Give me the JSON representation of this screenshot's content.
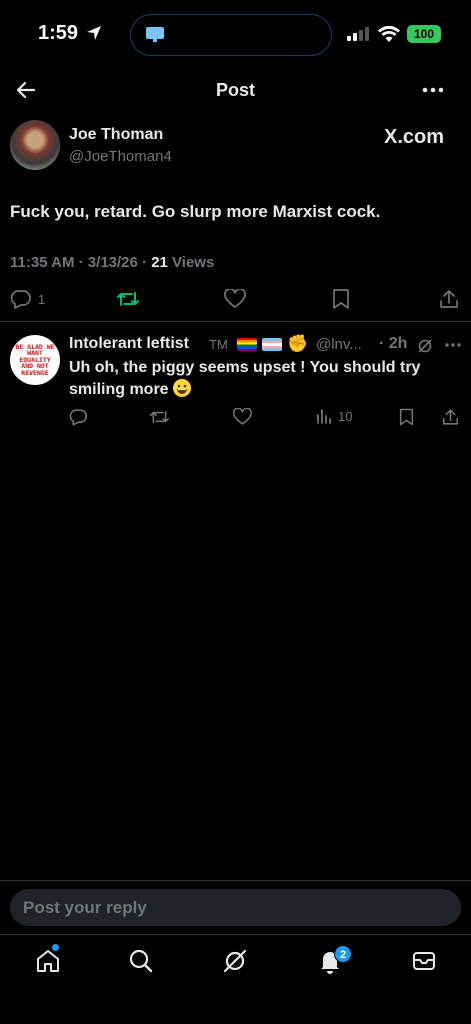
{
  "status_bar": {
    "time": "1:59",
    "battery": "100"
  },
  "header": {
    "title": "Post"
  },
  "post": {
    "author_name": "Joe Thoman",
    "author_handle": "@JoeThoman4",
    "source": "X.com",
    "text": "Fuck you, retard. Go slurp more Marxist cock.",
    "timestamp": "11:35 AM · 3/13/26 · ",
    "views_count": "21",
    "views_label": " Views",
    "reply_count": "1",
    "colors": {
      "repost_active": "#00ba7c"
    }
  },
  "reply": {
    "author_name": "Intolerant leftist",
    "tm": "TM",
    "handle": "@lnv...",
    "time": "· 2h",
    "text": "Uh oh, the piggy seems upset ! You should try smiling more",
    "views_count": "10",
    "avatar_text": "BE GLAD WE WANT EQUALITY AND NOT REVENGE"
  },
  "reply_box": {
    "placeholder": "Post your reply"
  },
  "tabbar": {
    "notifications_badge": "2"
  }
}
